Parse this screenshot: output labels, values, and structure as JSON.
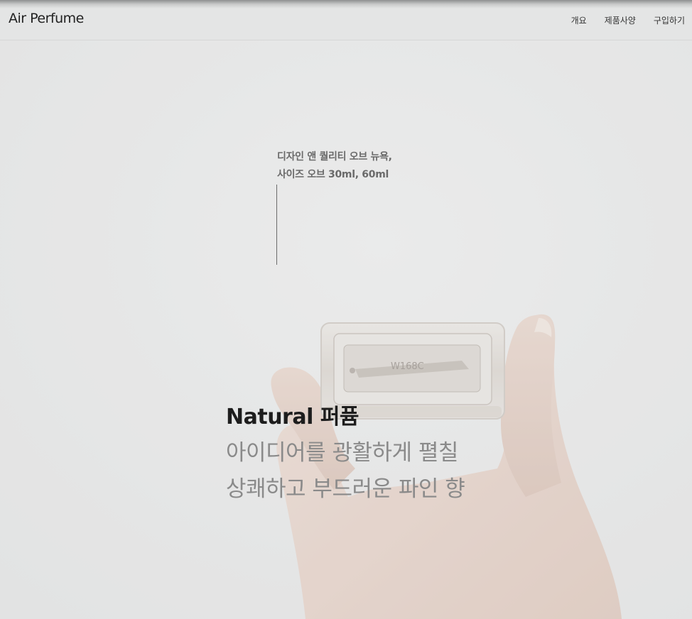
{
  "header": {
    "logo": "Air Perfume",
    "nav": [
      {
        "label": "개요"
      },
      {
        "label": "제품사양"
      },
      {
        "label": "구입하기"
      }
    ]
  },
  "hero": {
    "caption_line1": "디자인 앤 퀄리티 오브 뉴욕,",
    "caption_line2": "사이즈 오브 30ml, 60ml",
    "title": "Natural 퍼퓸",
    "subtitle_line1": "아이디어를 광활하게 펼칠",
    "subtitle_line2": "상쾌하고 부드러운 파인 향",
    "bottle_label": "W168C"
  },
  "colors": {
    "background": "#e4e5e5",
    "text_dark": "#1d1d1d",
    "text_muted": "#8a8a8a"
  }
}
